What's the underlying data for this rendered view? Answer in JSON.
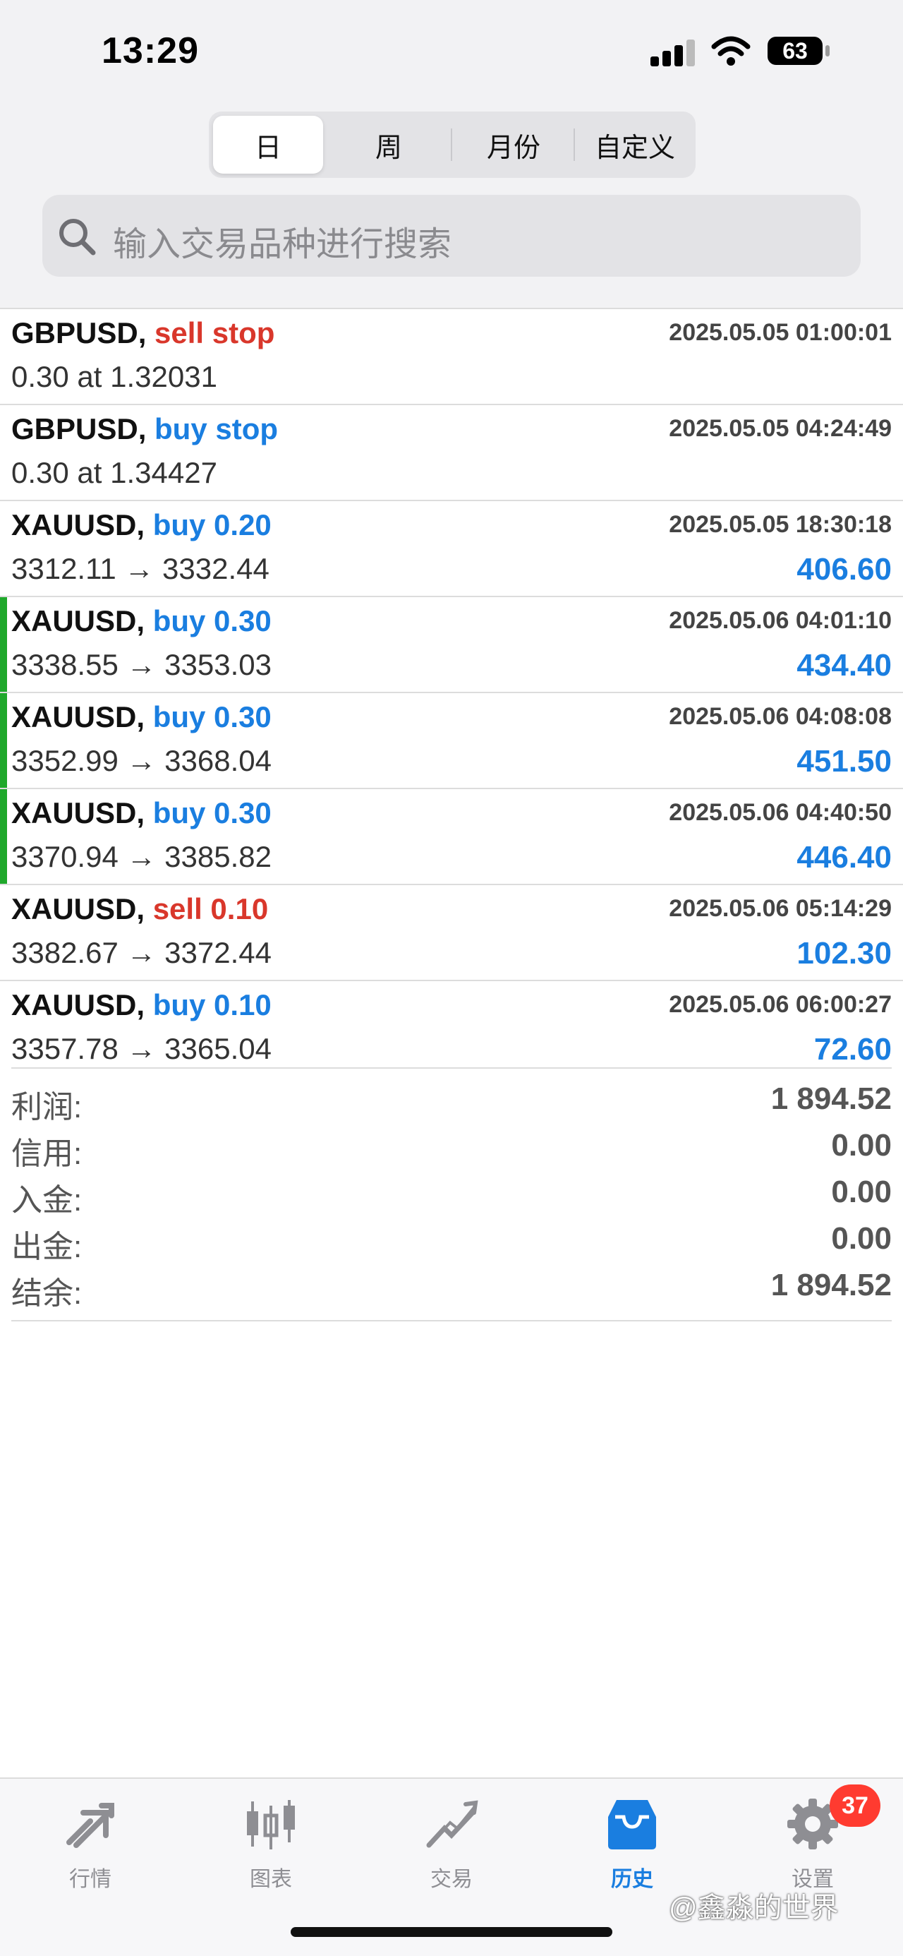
{
  "status_bar": {
    "time": "13:29",
    "battery": "63"
  },
  "period_tabs": [
    {
      "label": "日",
      "active": true
    },
    {
      "label": "周",
      "active": false
    },
    {
      "label": "月份",
      "active": false
    },
    {
      "label": "自定义",
      "active": false
    }
  ],
  "search": {
    "placeholder": "输入交易品种进行搜索"
  },
  "trades": [
    {
      "symbol": "GBPUSD,",
      "action": "sell stop",
      "action_color": "#d9372b",
      "datetime": "2025.05.05 01:00:01",
      "prices": "0.30 at 1.32031",
      "profit": "",
      "highlight": false
    },
    {
      "symbol": "GBPUSD,",
      "action": "buy stop",
      "action_color": "#1a7ee0",
      "datetime": "2025.05.05 04:24:49",
      "prices": "0.30 at 1.34427",
      "profit": "",
      "highlight": false
    },
    {
      "symbol": "XAUUSD,",
      "action": "buy 0.20",
      "action_color": "#1a7ee0",
      "datetime": "2025.05.05 18:30:18",
      "prices": "3312.11 → 3332.44",
      "profit": "406.60",
      "highlight": false
    },
    {
      "symbol": "XAUUSD,",
      "action": "buy 0.30",
      "action_color": "#1a7ee0",
      "datetime": "2025.05.06 04:01:10",
      "prices": "3338.55 → 3353.03",
      "profit": "434.40",
      "highlight": true
    },
    {
      "symbol": "XAUUSD,",
      "action": "buy 0.30",
      "action_color": "#1a7ee0",
      "datetime": "2025.05.06 04:08:08",
      "prices": "3352.99 → 3368.04",
      "profit": "451.50",
      "highlight": true
    },
    {
      "symbol": "XAUUSD,",
      "action": "buy 0.30",
      "action_color": "#1a7ee0",
      "datetime": "2025.05.06 04:40:50",
      "prices": "3370.94 → 3385.82",
      "profit": "446.40",
      "highlight": true
    },
    {
      "symbol": "XAUUSD,",
      "action": "sell 0.10",
      "action_color": "#d9372b",
      "datetime": "2025.05.06 05:14:29",
      "prices": "3382.67 → 3372.44",
      "profit": "102.30",
      "highlight": false
    },
    {
      "symbol": "XAUUSD,",
      "action": "buy 0.10",
      "action_color": "#1a7ee0",
      "datetime": "2025.05.06 06:00:27",
      "prices": "3357.78 → 3365.04",
      "profit": "72.60",
      "highlight": false
    }
  ],
  "summary": [
    {
      "label": "利润:",
      "value": "1 894.52"
    },
    {
      "label": "信用:",
      "value": "0.00"
    },
    {
      "label": "入金:",
      "value": "0.00"
    },
    {
      "label": "出金:",
      "value": "0.00"
    },
    {
      "label": "结余:",
      "value": "1 894.52"
    }
  ],
  "tabbar": [
    {
      "label": "行情",
      "icon": "quotes-icon",
      "active": false
    },
    {
      "label": "图表",
      "icon": "chart-icon",
      "active": false
    },
    {
      "label": "交易",
      "icon": "trade-icon",
      "active": false
    },
    {
      "label": "历史",
      "icon": "history-icon",
      "active": true
    },
    {
      "label": "设置",
      "icon": "gear-icon",
      "active": false
    }
  ],
  "settings_badge": "37",
  "watermark": "@鑫淼的世界",
  "colors": {
    "accent_blue": "#1a7ee0",
    "sell_red": "#d9372b",
    "highlight_green": "#1fa82b",
    "badge_red": "#ff3b30"
  }
}
